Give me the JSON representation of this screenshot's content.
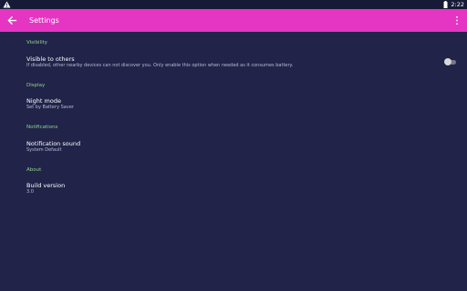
{
  "status_bar": {
    "time": "2:22",
    "icons": [
      "warning-icon",
      "battery-icon"
    ]
  },
  "app_bar": {
    "title": "Settings",
    "back_icon": "arrow-left-icon",
    "menu_icon": "more-vertical-icon"
  },
  "colors": {
    "accent": "#e535c3",
    "background": "#212349",
    "section_header": "#8fd48a"
  },
  "sections": [
    {
      "header": "Visibility",
      "title": "Visible to others",
      "summary": "If disabled, other nearby devices can not discover you. Only enable this option when needed as it consumes battery.",
      "toggle_on": false
    },
    {
      "header": "Display",
      "title": "Night mode",
      "summary": "Set by Battery Saver"
    },
    {
      "header": "Notifications",
      "title": "Notification sound",
      "summary": "System Default"
    },
    {
      "header": "About",
      "title": "Build version",
      "summary": "3.0"
    }
  ]
}
